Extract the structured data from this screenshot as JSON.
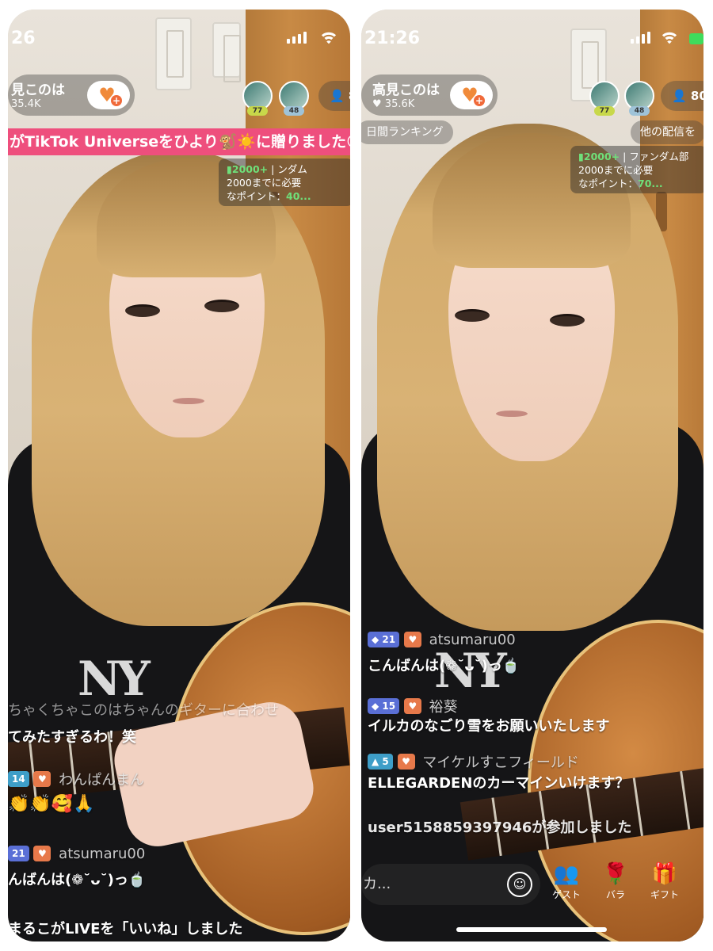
{
  "left": {
    "time": "26",
    "host_name": "見このは",
    "likes": "35.4K",
    "avatars": [
      {
        "level": "77"
      },
      {
        "level": "48"
      }
    ],
    "viewers": "8",
    "banner": "がTikTok Universeをひより🐒☀️に贈りました😊",
    "rank": {
      "count": "2000+",
      "sep": "|",
      "tag": "ンダム",
      "line2": "2000までに必要",
      "line3_label": "なポイント：",
      "line3_value": "40..."
    },
    "shirt_logo": "NY",
    "chat": {
      "faded_1": "ちゃくちゃこのはちゃんのギターに合わせ",
      "faded_2": "てみたすぎるわ！笑",
      "user_a_level": "14",
      "user_a_name": "わんぱんまん",
      "user_a_msg": "👏👏🥰🙏",
      "user_b_level": "21",
      "user_b_name": "atsumaru00",
      "user_b_msg": "んばんは(❁˘ᴗ˘)っ🍵",
      "system": "まるこがLIVEを「いいね」しました"
    }
  },
  "right": {
    "time": "21:26",
    "host_name": "高見このは",
    "likes": "35.6K",
    "avatars": [
      {
        "level": "77"
      },
      {
        "level": "48"
      }
    ],
    "viewers": "80",
    "ranking_chip": "日間ランキング",
    "other_chip": "他の配信を",
    "rank": {
      "count": "2000+",
      "sep": "|",
      "tag": "ファンダム部",
      "line2": "2000までに必要",
      "line3_label": "なポイント：",
      "line3_value": "70..."
    },
    "shirt_logo": "NY",
    "chat": {
      "m1_level": "21",
      "m1_name": "atsumaru00",
      "m1_msg": "こんばんは(❁˘ᴗ˘)っ🍵",
      "m2_level": "15",
      "m2_name": "裕葵",
      "m2_msg": "イルカのなごり雪をお願いいたします",
      "m3_level": "5",
      "m3_name": "マイケルすこフィールド",
      "m3_msg": "ELLEGARDENのカーマインいけます？",
      "system": "user5158859397946が参加しました"
    },
    "input_placeholder": "カ...",
    "actions": [
      {
        "label": "ゲスト",
        "icon": "guest-icon"
      },
      {
        "label": "バラ",
        "icon": "rose-icon"
      },
      {
        "label": "ギフト",
        "icon": "gift-icon"
      }
    ]
  }
}
